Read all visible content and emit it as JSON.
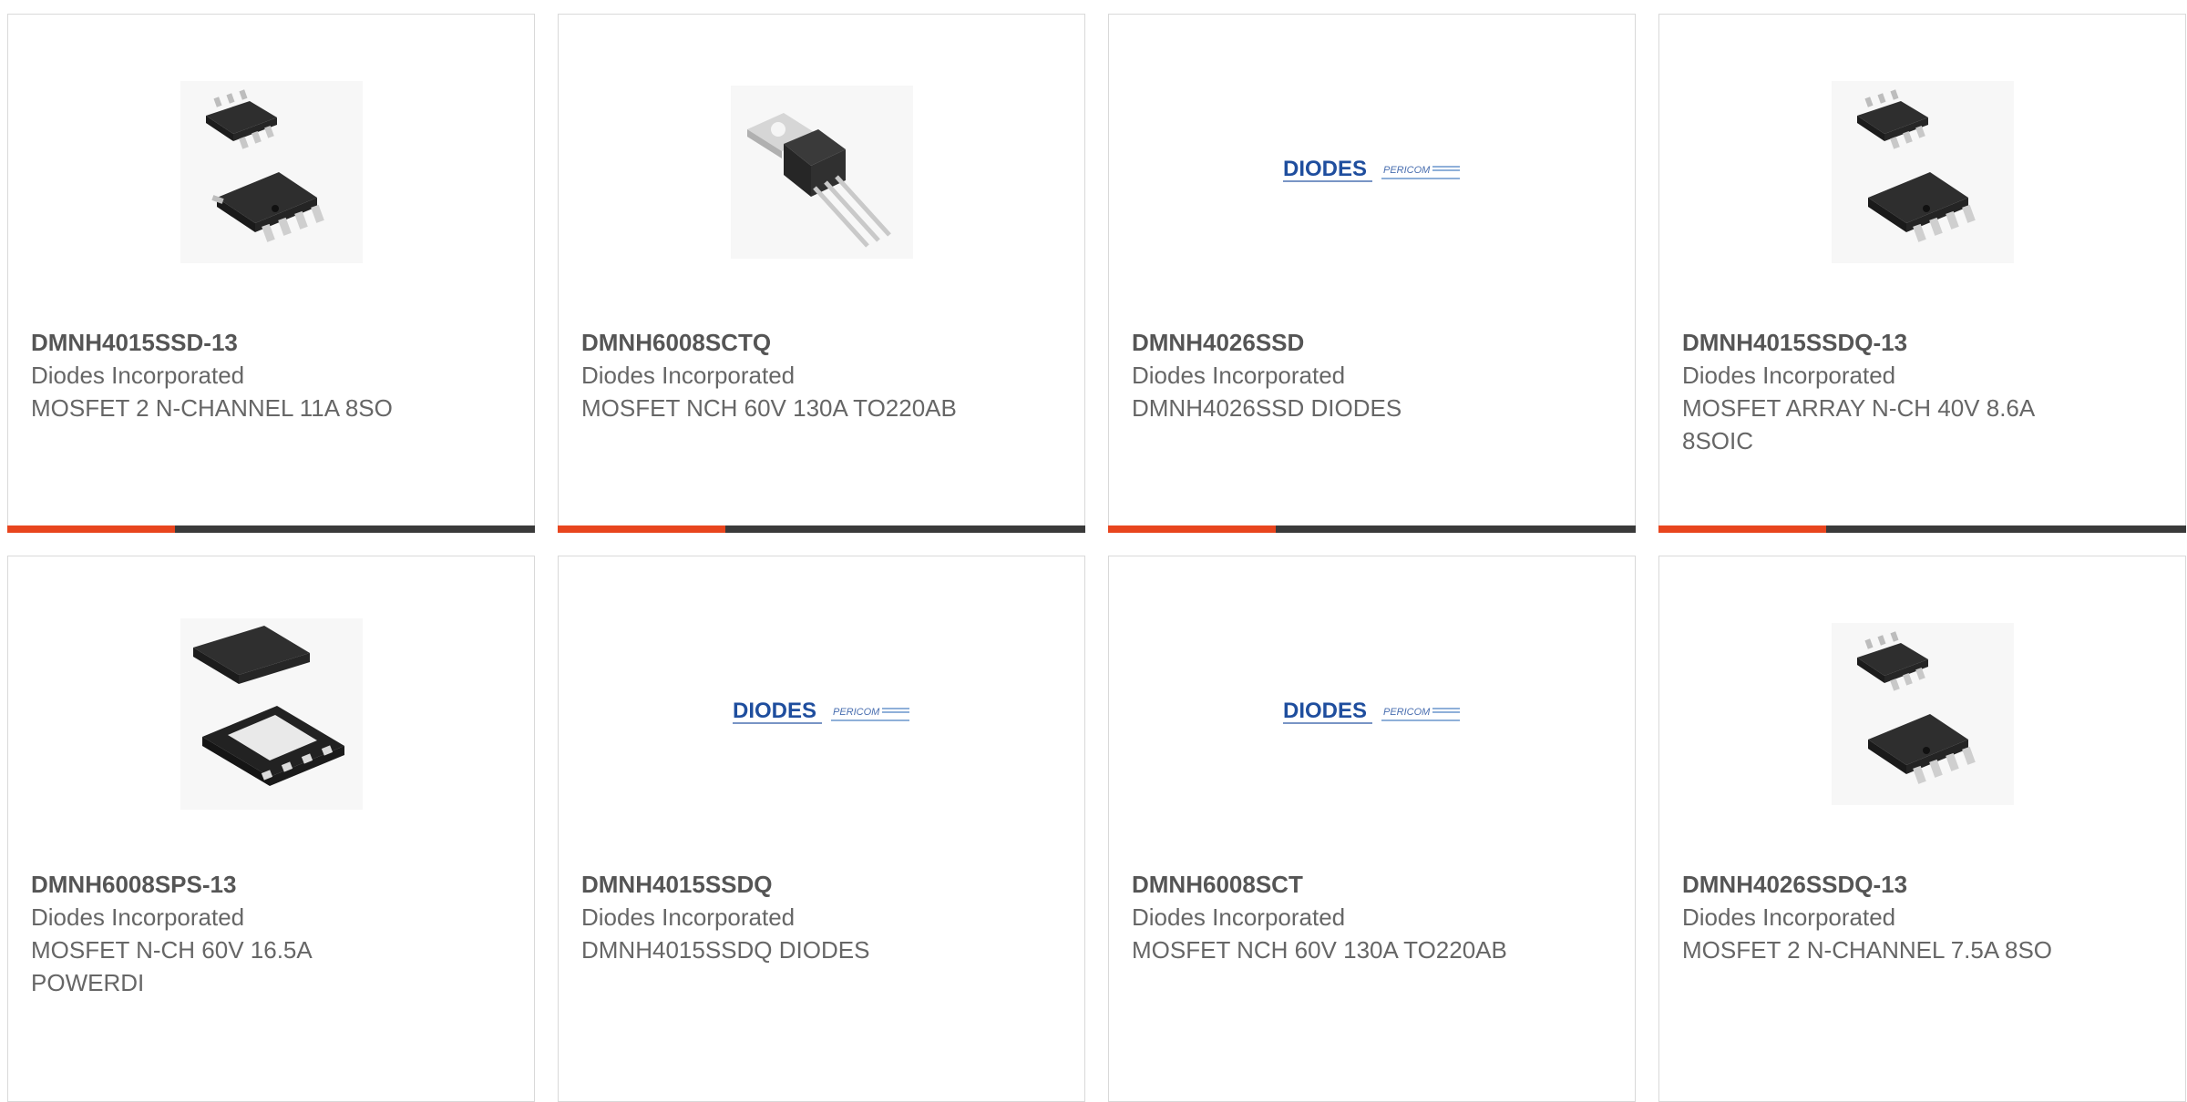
{
  "products": [
    {
      "part_number": "DMNH4015SSD-13",
      "manufacturer": "Diodes Incorporated",
      "description": "MOSFET 2 N-CHANNEL 11A 8SO",
      "image": "so8-dual-package-icon"
    },
    {
      "part_number": "DMNH6008SCTQ",
      "manufacturer": "Diodes Incorporated",
      "description": "MOSFET NCH 60V 130A TO220AB",
      "image": "to220-package-icon"
    },
    {
      "part_number": "DMNH4026SSD",
      "manufacturer": "Diodes Incorporated",
      "description": "DMNH4026SSD DIODES",
      "image": "diodes-pericom-logo"
    },
    {
      "part_number": "DMNH4015SSDQ-13",
      "manufacturer": "Diodes Incorporated",
      "description": "MOSFET ARRAY N-CH 40V 8.6A 8SOIC",
      "image": "so8-dual-package-icon"
    },
    {
      "part_number": "DMNH6008SPS-13",
      "manufacturer": "Diodes Incorporated",
      "description": "MOSFET N-CH 60V 16.5A POWERDI",
      "image": "powerdi-package-icon"
    },
    {
      "part_number": "DMNH4015SSDQ",
      "manufacturer": "Diodes Incorporated",
      "description": "DMNH4015SSDQ DIODES",
      "image": "diodes-pericom-logo"
    },
    {
      "part_number": "DMNH6008SCT",
      "manufacturer": "Diodes Incorporated",
      "description": "MOSFET NCH 60V 130A TO220AB",
      "image": "diodes-pericom-logo"
    },
    {
      "part_number": "DMNH4026SSDQ-13",
      "manufacturer": "Diodes Incorporated",
      "description": "MOSFET 2 N-CHANNEL 7.5A 8SO",
      "image": "so8-dual-package-icon"
    }
  ],
  "logo": {
    "brand": "DIODES",
    "sub_brand": "PERICOM"
  },
  "colors": {
    "accent": "#e8451e",
    "bar": "#3a3a3a",
    "border": "#d9d9d9",
    "text": "#666666"
  }
}
